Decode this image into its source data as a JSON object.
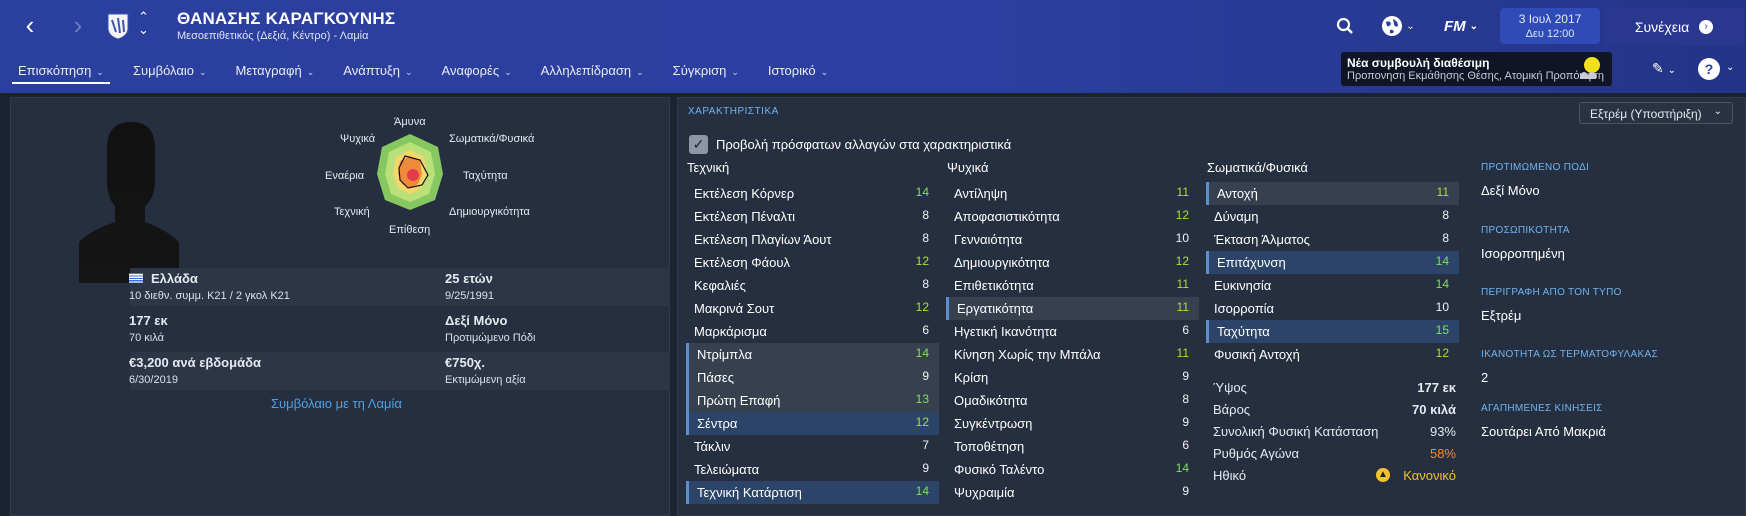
{
  "header": {
    "player_name": "ΘΑΝΑΣΗΣ ΚΑΡΑΓΚΟΥΝΗΣ",
    "subtitle": "Μεσοεπιθετικός (Δεξιά, Κέντρο) - Λαμία",
    "fm_label": "FM",
    "date": "3 Ιουλ 2017",
    "time": "Δευ 12:00",
    "continue_label": "Συνέχεια",
    "tip_title": "Νέα συμβουλή διαθέσιμη",
    "tip_text": "Προπονηση Εκμάθησης Θέσης, Ατομική Προπόνηση"
  },
  "tabs": [
    {
      "label": "Επισκόπηση"
    },
    {
      "label": "Συμβόλαιο"
    },
    {
      "label": "Μεταγραφή"
    },
    {
      "label": "Ανάπτυξη"
    },
    {
      "label": "Αναφορές"
    },
    {
      "label": "Αλληλεπίδραση"
    },
    {
      "label": "Σύγκριση"
    },
    {
      "label": "Ιστορικό"
    }
  ],
  "radar": {
    "labels": [
      "Άμυνα",
      "Σωματικά/Φυσικά",
      "Ταχύτητα",
      "Δημιουργικότητα",
      "Επίθεση",
      "Τεχνική",
      "Εναέρια",
      "Ψυχικά"
    ]
  },
  "profile": {
    "nation": "Ελλάδα",
    "caps": "10 διεθν. συμμ. Κ21 / 2 γκολ Κ21",
    "age": "25 ετών",
    "dob": "9/25/1991",
    "height": "177 εκ",
    "weight": "70 κιλά",
    "foot": "Δεξί Μόνο",
    "foot_label": "Προτιμώμενο Πόδι",
    "wage": "€3,200 ανά εβδομάδα",
    "expires": "6/30/2019",
    "value": "€750χ.",
    "value_label": "Εκτιμώμενη αξία",
    "contract_link": "Συμβόλαιο με τη Λαμία"
  },
  "attributes": {
    "section_title": "ΧΑΡΑΚΤΗΡΙΣΤΙΚΑ",
    "dropdown": "Εξτρέμ (Υποστήριξη)",
    "recent_changes": "Προβολή πρόσφατων αλλαγών στα χαρακτηριστικά",
    "technical_title": "Τεχνική",
    "mental_title": "Ψυχικά",
    "physical_title": "Σωματικά/Φυσικά",
    "technical": [
      {
        "name": "Εκτέλεση Κόρνερ",
        "value": "14"
      },
      {
        "name": "Εκτέλεση Πέναλτι",
        "value": "8"
      },
      {
        "name": "Εκτέλεση Πλαγίων Άουτ",
        "value": "8"
      },
      {
        "name": "Εκτέλεση Φάουλ",
        "value": "12"
      },
      {
        "name": "Κεφαλιές",
        "value": "8"
      },
      {
        "name": "Μακρινά Σουτ",
        "value": "12"
      },
      {
        "name": "Μαρκάρισμα",
        "value": "6"
      },
      {
        "name": "Ντρίμπλα",
        "value": "14"
      },
      {
        "name": "Πάσες",
        "value": "9"
      },
      {
        "name": "Πρώτη Επαφή",
        "value": "13"
      },
      {
        "name": "Σέντρα",
        "value": "12"
      },
      {
        "name": "Τάκλιν",
        "value": "7"
      },
      {
        "name": "Τελειώματα",
        "value": "9"
      },
      {
        "name": "Τεχνική Κατάρτιση",
        "value": "14"
      }
    ],
    "mental": [
      {
        "name": "Αντίληψη",
        "value": "11"
      },
      {
        "name": "Αποφασιστικότητα",
        "value": "12"
      },
      {
        "name": "Γενναιότητα",
        "value": "10"
      },
      {
        "name": "Δημιουργικότητα",
        "value": "12"
      },
      {
        "name": "Επιθετικότητα",
        "value": "11"
      },
      {
        "name": "Εργατικότητα",
        "value": "11"
      },
      {
        "name": "Ηγετική Ικανότητα",
        "value": "6"
      },
      {
        "name": "Κίνηση Χωρίς την Μπάλα",
        "value": "11"
      },
      {
        "name": "Κρίση",
        "value": "9"
      },
      {
        "name": "Ομαδικότητα",
        "value": "8"
      },
      {
        "name": "Συγκέντρωση",
        "value": "9"
      },
      {
        "name": "Τοποθέτηση",
        "value": "6"
      },
      {
        "name": "Φυσικό Ταλέντο",
        "value": "14"
      },
      {
        "name": "Ψυχραιμία",
        "value": "9"
      }
    ],
    "physical": [
      {
        "name": "Αντοχή",
        "value": "11"
      },
      {
        "name": "Δύναμη",
        "value": "8"
      },
      {
        "name": "Έκταση Άλματος",
        "value": "8"
      },
      {
        "name": "Επιτάχυνση",
        "value": "14"
      },
      {
        "name": "Ευκινησία",
        "value": "14"
      },
      {
        "name": "Ισορροπία",
        "value": "10"
      },
      {
        "name": "Ταχύτητα",
        "value": "15"
      },
      {
        "name": "Φυσική Αντοχή",
        "value": "12"
      }
    ],
    "physical_info": [
      {
        "name": "Ύψος",
        "value": "177 εκ"
      },
      {
        "name": "Βάρος",
        "value": "70 κιλά"
      },
      {
        "name": "Συνολική Φυσική Κατάσταση",
        "value": "93%"
      },
      {
        "name": "Ρυθμός Αγώνα",
        "value": "58%"
      },
      {
        "name": "Ηθικό",
        "value": "Κανονικό"
      }
    ]
  },
  "side": {
    "foot_h": "ΠΡΟΤΙΜΩΜΕΝΟ ΠΟΔΙ",
    "foot_v": "Δεξί Μόνο",
    "pers_h": "ΠΡΟΣΩΠΙΚΟΤΗΤΑ",
    "pers_v": "Ισορροπημένη",
    "type_h": "ΠΕΡΙΓΡΑΦΗ ΑΠΟ ΤΟΝ ΤΥΠΟ",
    "type_v": "Εξτρέμ",
    "gk_h": "ΙΚΑΝΟΤΗΤΑ ΩΣ ΤΕΡΜΑΤΟΦΥΛΑΚΑΣ",
    "gk_v": "2",
    "moves_h": "ΑΓΑΠΗΜΕΝΕΣ ΚΙΝΗΣΕΙΣ",
    "moves_v": "Σουτάρει Από Μακριά"
  },
  "colors": {
    "accent": "#2b3f9e",
    "green_value": "#7fe05a",
    "orange_value": "#f08a3a",
    "link": "#4aa3e8"
  }
}
